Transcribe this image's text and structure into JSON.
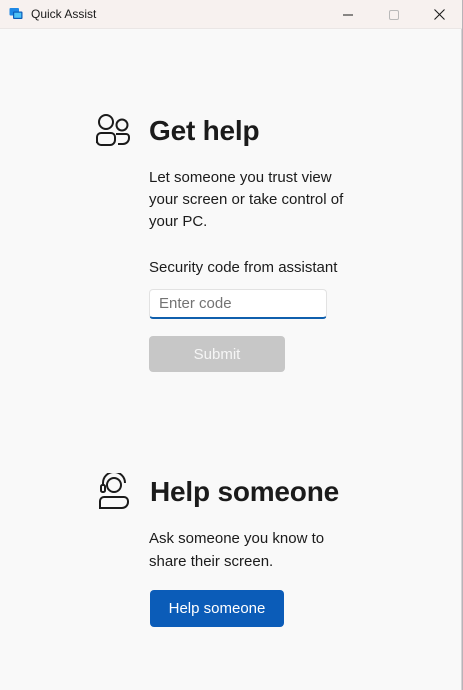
{
  "window": {
    "title": "Quick Assist",
    "accent_color": "#0b5cb8",
    "app_icon": "quick-assist-icon"
  },
  "get_help": {
    "icon": "people-icon",
    "heading": "Get help",
    "description_lines": [
      "Let someone you trust view",
      "your screen or take control of",
      "your PC."
    ],
    "code_label": "Security code from assistant",
    "code_value": "",
    "code_placeholder": "Enter code",
    "submit_label": "Submit",
    "submit_enabled": false
  },
  "help_someone": {
    "icon": "person-headset-icon",
    "heading": "Help someone",
    "description_lines": [
      "Ask someone you know to",
      "share their screen."
    ],
    "button_label": "Help someone"
  }
}
